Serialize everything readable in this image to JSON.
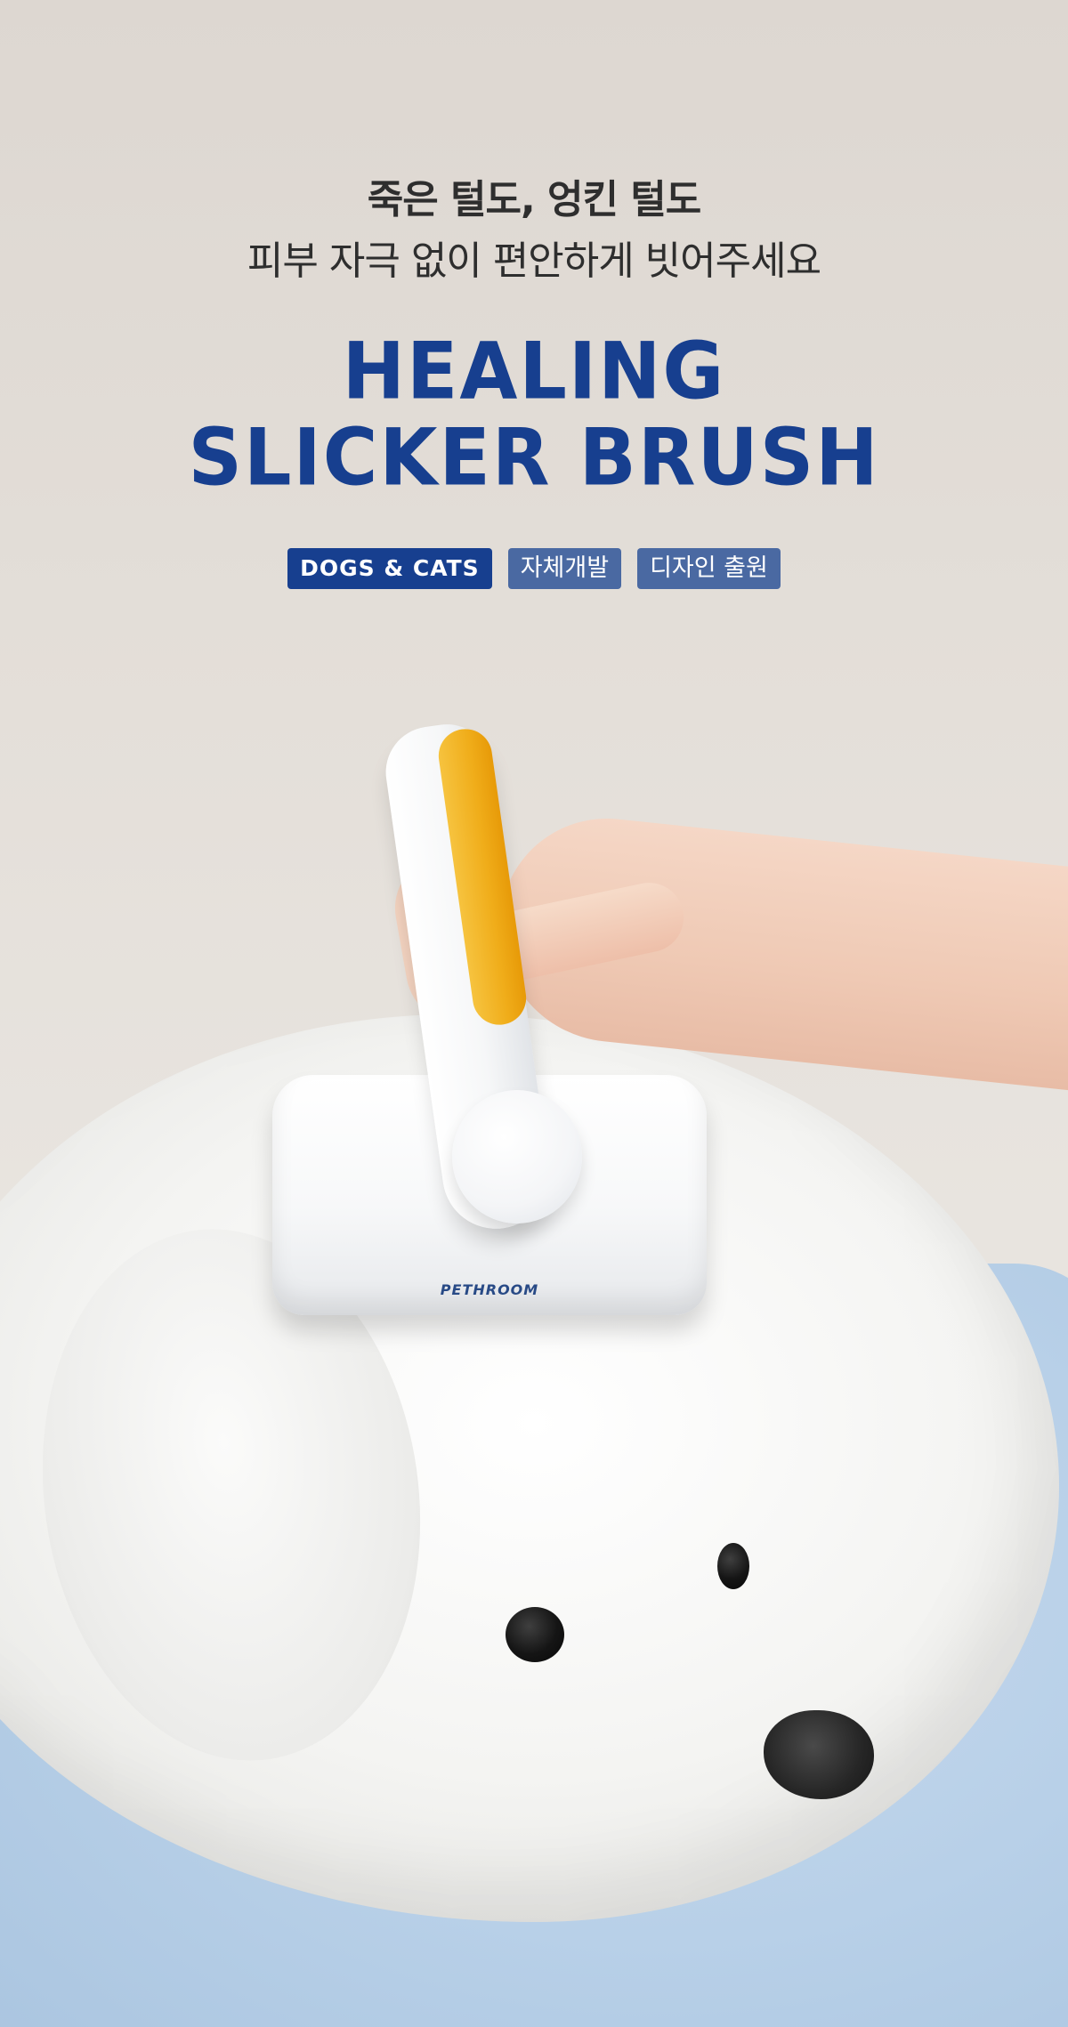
{
  "hero": {
    "line1": "죽은 털도, 엉킨 털도",
    "line2": "피부 자극 없이 편안하게 빗어주세요",
    "title_line1": "HEALING",
    "title_line2": "SLICKER BRUSH"
  },
  "badges": [
    {
      "label": "DOGS & CATS"
    },
    {
      "label": "자체개발"
    },
    {
      "label": "디자인 출원"
    }
  ],
  "product": {
    "brand": "PETHROOM"
  },
  "colors": {
    "title": "#173f8f",
    "badge_primary": "#173f8f",
    "badge_secondary": "#4a69a2",
    "grip": "#f0ad1a"
  }
}
